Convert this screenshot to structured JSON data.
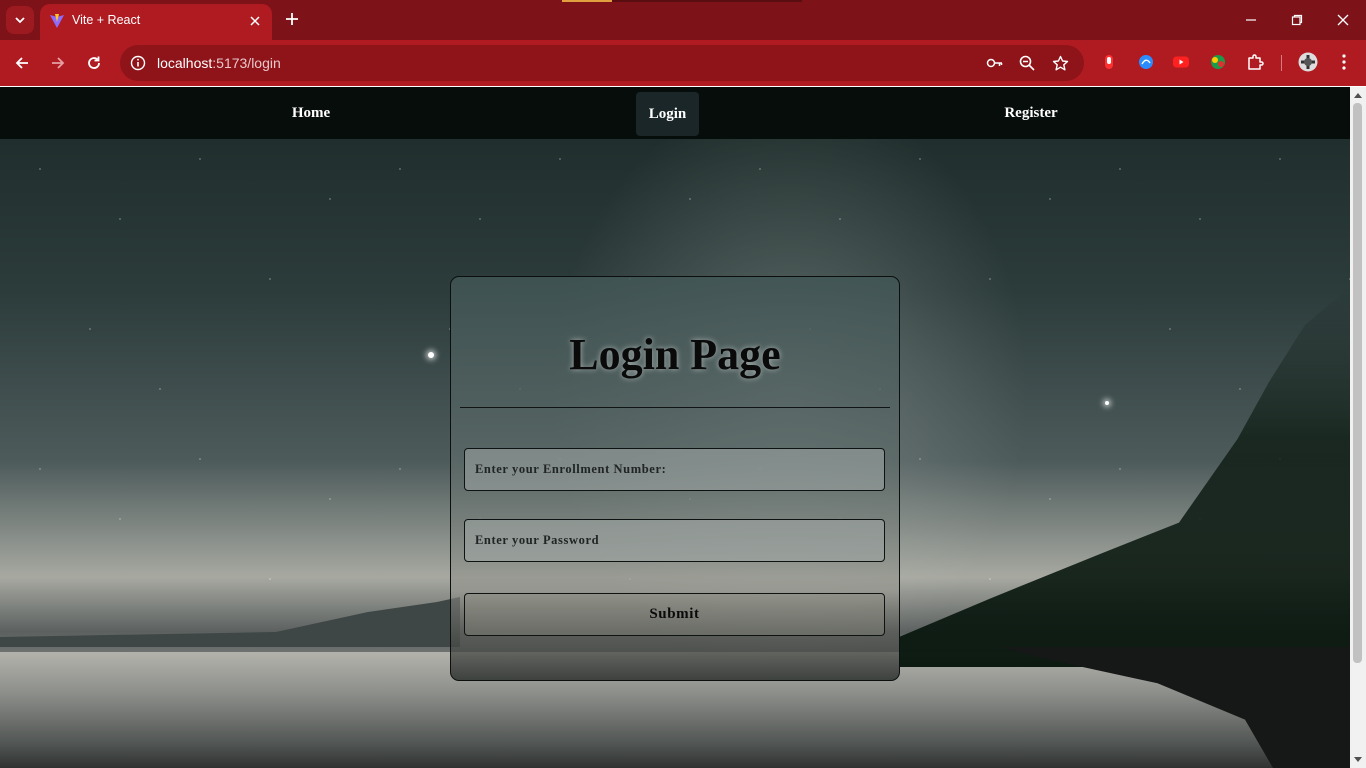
{
  "browser": {
    "tab_title": "Vite + React",
    "url_host": "localhost",
    "url_path": ":5173/login",
    "colors": {
      "tabbar": "#7d1318",
      "toolbar": "#b01b22"
    }
  },
  "nav": {
    "items": [
      {
        "label": "Home"
      },
      {
        "label": "Login",
        "active": true
      },
      {
        "label": "Register"
      }
    ]
  },
  "login": {
    "title": "Login Page",
    "enrollment_placeholder": "Enter your Enrollment Number:",
    "password_placeholder": "Enter your Password",
    "submit_label": "Submit"
  }
}
